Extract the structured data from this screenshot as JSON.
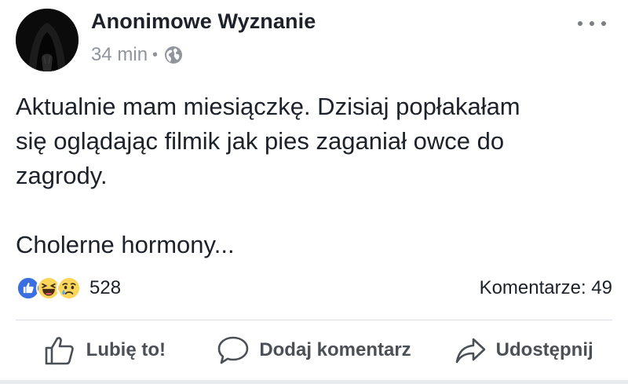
{
  "post": {
    "author": "Anonimowe Wyznanie",
    "time": "34 min",
    "separator": "•",
    "privacy_icon": "globe-icon",
    "more_icon": "more-horizontal-icon",
    "paragraphs": [
      "Aktualnie mam miesiączkę. Dzisiaj popłakałam\nsię oglądając filmik jak pies zaganiał owce do\nzagrody.",
      "Cholerne hormony..."
    ]
  },
  "reactions": {
    "icons": [
      "like-reaction-icon",
      "haha-reaction-icon",
      "sad-reaction-icon"
    ],
    "count": "528",
    "comments": "Komentarze: 49"
  },
  "actions": {
    "like": {
      "label": "Lubię to!",
      "icon": "thumbs-up-icon"
    },
    "comment": {
      "label": "Dodaj komentarz",
      "icon": "speech-bubble-icon"
    },
    "share": {
      "label": "Udostępnij",
      "icon": "share-arrow-icon"
    }
  },
  "colors": {
    "text": "#1d2129",
    "secondary_text": "#90949c",
    "action_text": "#4b4f56",
    "like_blue": "#3b6fe0",
    "emoji_yellow": "#fcd65a",
    "divider": "#dadde1"
  }
}
